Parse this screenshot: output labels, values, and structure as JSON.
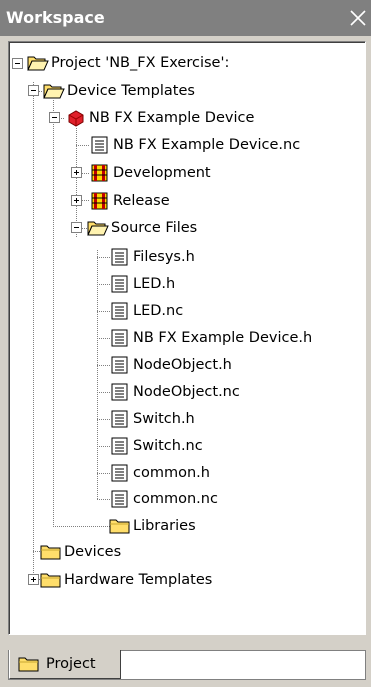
{
  "window": {
    "title": "Workspace"
  },
  "tree": {
    "nodes": [
      {
        "label": "Project 'NB_FX Exercise':",
        "icon": "open-folder-icon"
      },
      {
        "label": "Device Templates",
        "icon": "open-folder-icon"
      },
      {
        "label": "NB FX Example Device",
        "icon": "red-device-icon"
      },
      {
        "label": "NB FX Example Device.nc",
        "icon": "document-icon"
      },
      {
        "label": "Development",
        "icon": "build-config-icon"
      },
      {
        "label": "Release",
        "icon": "build-config-icon"
      },
      {
        "label": "Source Files",
        "icon": "open-folder-icon"
      },
      {
        "label": "Filesys.h",
        "icon": "document-icon"
      },
      {
        "label": "LED.h",
        "icon": "document-icon"
      },
      {
        "label": "LED.nc",
        "icon": "document-icon"
      },
      {
        "label": "NB FX Example Device.h",
        "icon": "document-icon"
      },
      {
        "label": "NodeObject.h",
        "icon": "document-icon"
      },
      {
        "label": "NodeObject.nc",
        "icon": "document-icon"
      },
      {
        "label": "Switch.h",
        "icon": "document-icon"
      },
      {
        "label": "Switch.nc",
        "icon": "document-icon"
      },
      {
        "label": "common.h",
        "icon": "document-icon"
      },
      {
        "label": "common.nc",
        "icon": "document-icon"
      },
      {
        "label": "Libraries",
        "icon": "closed-folder-icon"
      },
      {
        "label": "Devices",
        "icon": "closed-folder-icon"
      },
      {
        "label": "Hardware Templates",
        "icon": "closed-folder-icon"
      }
    ]
  },
  "tabs": [
    {
      "label": "Project",
      "icon": "folder-icon",
      "active": true
    }
  ],
  "colors": {
    "titlebar": "#808080",
    "chrome": "#d4d0c8",
    "folder": "#ffde6b",
    "device": "#e0202a"
  }
}
